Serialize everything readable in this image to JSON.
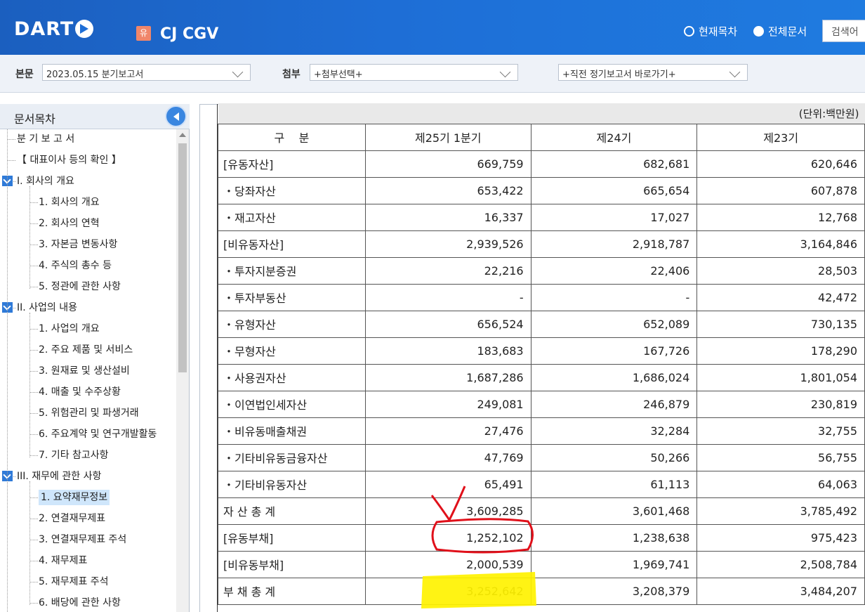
{
  "header": {
    "logo": "DART",
    "badge": "유",
    "company": "CJ CGV",
    "radio_current": "현재목차",
    "radio_all": "전체문서",
    "search_placeholder": "검색어"
  },
  "subbar": {
    "body_label": "본문",
    "body_value": "2023.05.15  분기보고서",
    "attach_label": "첨부",
    "attach_value": "+첨부선택+",
    "prev_value": "+직전 정기보고서 바로가기+"
  },
  "sidebar": {
    "title": "문서목차",
    "items": [
      {
        "label": "분 기 보 고 서",
        "level": 0
      },
      {
        "label": "【 대표이사 등의 확인 】",
        "level": 0
      },
      {
        "label": "I. 회사의 개요",
        "level": 0,
        "toggle": true
      },
      {
        "label": "1. 회사의 개요",
        "level": 1
      },
      {
        "label": "2. 회사의 연혁",
        "level": 1
      },
      {
        "label": "3. 자본금 변동사항",
        "level": 1
      },
      {
        "label": "4. 주식의 총수 등",
        "level": 1
      },
      {
        "label": "5. 정관에 관한 사항",
        "level": 1
      },
      {
        "label": "II. 사업의 내용",
        "level": 0,
        "toggle": true
      },
      {
        "label": "1. 사업의 개요",
        "level": 1
      },
      {
        "label": "2. 주요 제품 및 서비스",
        "level": 1
      },
      {
        "label": "3. 원재료 및 생산설비",
        "level": 1
      },
      {
        "label": "4. 매출 및 수주상황",
        "level": 1
      },
      {
        "label": "5. 위험관리 및 파생거래",
        "level": 1
      },
      {
        "label": "6. 주요계약 및 연구개발활동",
        "level": 1
      },
      {
        "label": "7. 기타 참고사항",
        "level": 1
      },
      {
        "label": "III. 재무에 관한 사항",
        "level": 0,
        "toggle": true
      },
      {
        "label": "1. 요약재무정보",
        "level": 1,
        "active": true
      },
      {
        "label": "2. 연결재무제표",
        "level": 1
      },
      {
        "label": "3. 연결재무제표 주석",
        "level": 1
      },
      {
        "label": "4. 재무제표",
        "level": 1
      },
      {
        "label": "5. 재무제표 주석",
        "level": 1
      },
      {
        "label": "6. 배당에 관한 사항",
        "level": 1
      }
    ]
  },
  "table": {
    "unit": "(단위:백만원)",
    "headers": [
      "구    분",
      "제25기 1분기",
      "제24기",
      "제23기"
    ],
    "rows": [
      [
        "[유동자산]",
        "669,759",
        "682,681",
        "620,646"
      ],
      [
        "・당좌자산",
        "653,422",
        "665,654",
        "607,878"
      ],
      [
        "・재고자산",
        "16,337",
        "17,027",
        "12,768"
      ],
      [
        "[비유동자산]",
        "2,939,526",
        "2,918,787",
        "3,164,846"
      ],
      [
        "・투자지분증권",
        "22,216",
        "22,406",
        "28,503"
      ],
      [
        "・투자부동산",
        "-",
        "-",
        "42,472"
      ],
      [
        "・유형자산",
        "656,524",
        "652,089",
        "730,135"
      ],
      [
        "・무형자산",
        "183,683",
        "167,726",
        "178,290"
      ],
      [
        "・사용권자산",
        "1,687,286",
        "1,686,024",
        "1,801,054"
      ],
      [
        "・이연법인세자산",
        "249,081",
        "246,879",
        "230,819"
      ],
      [
        "・비유동매출채권",
        "27,476",
        "32,284",
        "32,755"
      ],
      [
        "・기타비유동금융자산",
        "47,769",
        "50,266",
        "56,755"
      ],
      [
        "・기타비유동자산",
        "65,491",
        "61,113",
        "64,063"
      ],
      [
        "자 산 총 계",
        "3,609,285",
        "3,601,468",
        "3,785,492"
      ],
      [
        "[유동부채]",
        "1,252,102",
        "1,238,638",
        "975,423"
      ],
      [
        "[비유동부채]",
        "2,000,539",
        "1,969,741",
        "2,508,784"
      ],
      [
        "부 채 총 계",
        "3,252,642",
        "3,208,379",
        "3,484,207"
      ]
    ]
  },
  "colors": {
    "header_blue": "#1e6ed6",
    "annotation_red": "#e0101a",
    "highlight_yellow": "#fff200"
  }
}
